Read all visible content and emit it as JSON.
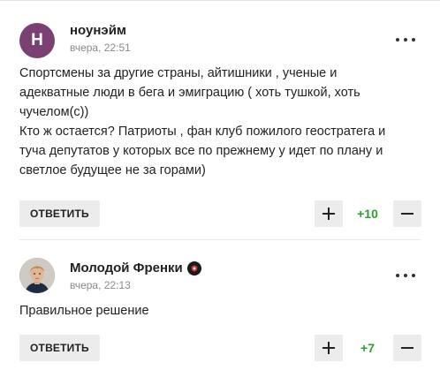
{
  "comments": [
    {
      "author": "ноунэйм",
      "avatar_letter": "Н",
      "avatar_color": "#7a3f73",
      "time": "вчера, 22:51",
      "lines": [
        "Спортсмены за другие страны, айтишники , ученые и",
        "адекватные люди в бега и эмиграцию ( хоть тушкой, хоть",
        "чучелом(с))",
        "Кто ж остается? Патриоты , фан клуб пожилого геостратега и",
        "туча депутатов у которых все по прежнему у идет по плану и",
        "светлое будущее не за горами)"
      ],
      "reply_label": "ОТВЕТИТЬ",
      "score": "+10"
    },
    {
      "author": "Молодой Френки",
      "badge_icon": "club-badge-icon",
      "time": "вчера, 22:13",
      "lines": [
        "Правильное решение"
      ],
      "reply_label": "ОТВЕТИТЬ",
      "score": "+7"
    }
  ],
  "colors": {
    "score_positive": "#2e9e2e",
    "button_bg": "#ececec"
  }
}
